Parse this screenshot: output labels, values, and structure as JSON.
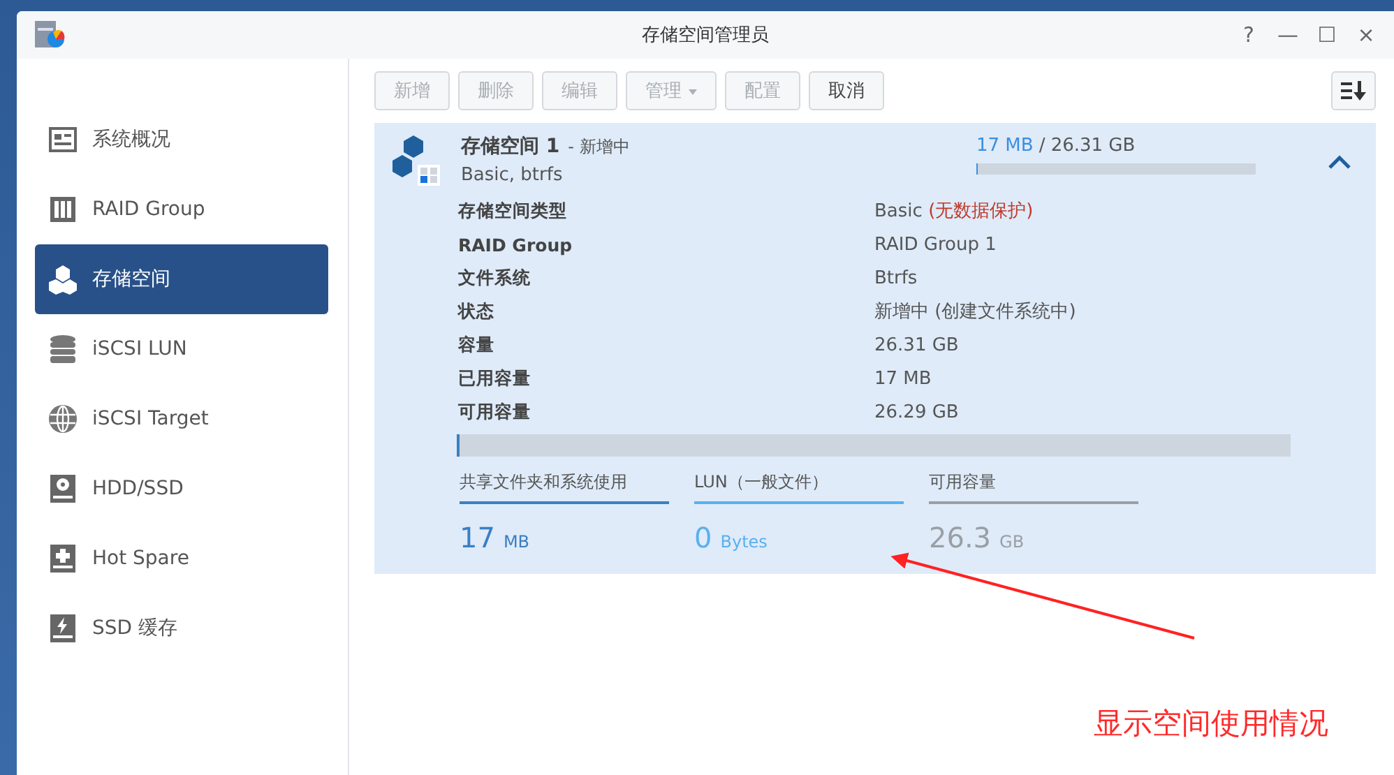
{
  "window": {
    "title": "存储空间管理员",
    "controls": [
      "?",
      "—",
      "☐",
      "×"
    ]
  },
  "sidebar": {
    "items": [
      {
        "label": "系统概况",
        "selected": false
      },
      {
        "label": "RAID Group",
        "selected": false
      },
      {
        "label": "存储空间",
        "selected": true
      },
      {
        "label": "iSCSI LUN",
        "selected": false
      },
      {
        "label": "iSCSI Target",
        "selected": false
      },
      {
        "label": "HDD/SSD",
        "selected": false
      },
      {
        "label": "Hot Spare",
        "selected": false
      },
      {
        "label": "SSD 缓存",
        "selected": false
      }
    ]
  },
  "toolbar": {
    "buttons": [
      {
        "label": "新增",
        "kind": "button",
        "disabled": true
      },
      {
        "label": "删除",
        "kind": "button",
        "disabled": true
      },
      {
        "label": "编辑",
        "kind": "button",
        "disabled": true
      },
      {
        "label": "管理",
        "kind": "dropdown",
        "disabled": true
      },
      {
        "label": "配置",
        "kind": "button",
        "disabled": true
      },
      {
        "label": "取消",
        "kind": "button",
        "disabled": false
      }
    ]
  },
  "volume": {
    "title": "存储空间 1",
    "status": "- 新增中",
    "subtitle": "Basic, btrfs",
    "used": "17 MB",
    "total": "/ 26.31 GB",
    "level": 0.002,
    "expanded": true,
    "details": [
      {
        "label": "存储空间类型",
        "value": "Basic",
        "note": "(无数据保护)"
      },
      {
        "label": "RAID Group",
        "value": "RAID Group 1"
      },
      {
        "label": "文件系统",
        "value": "Btrfs"
      },
      {
        "label": "状态",
        "value": "新增中 (创建文件系统中)"
      },
      {
        "label": "容量",
        "value": "26.31 GB"
      },
      {
        "label": "已用容量",
        "value": "17 MB"
      },
      {
        "label": "可用容量",
        "value": "26.29 GB"
      }
    ],
    "usage_bar": {
      "level": 0.002
    },
    "segments": [
      {
        "label": "共享文件夹和系统使用",
        "number": "17",
        "unit": "MB",
        "color": "#3a7fc4"
      },
      {
        "label": "LUN（一般文件）",
        "number": "0",
        "unit": "Bytes",
        "color": "#5ab0ee"
      },
      {
        "label": "可用容量",
        "number": "26.3",
        "unit": "GB",
        "color": "#9a9fa6"
      }
    ]
  },
  "annotation": {
    "text": "显示空间使用情况"
  }
}
